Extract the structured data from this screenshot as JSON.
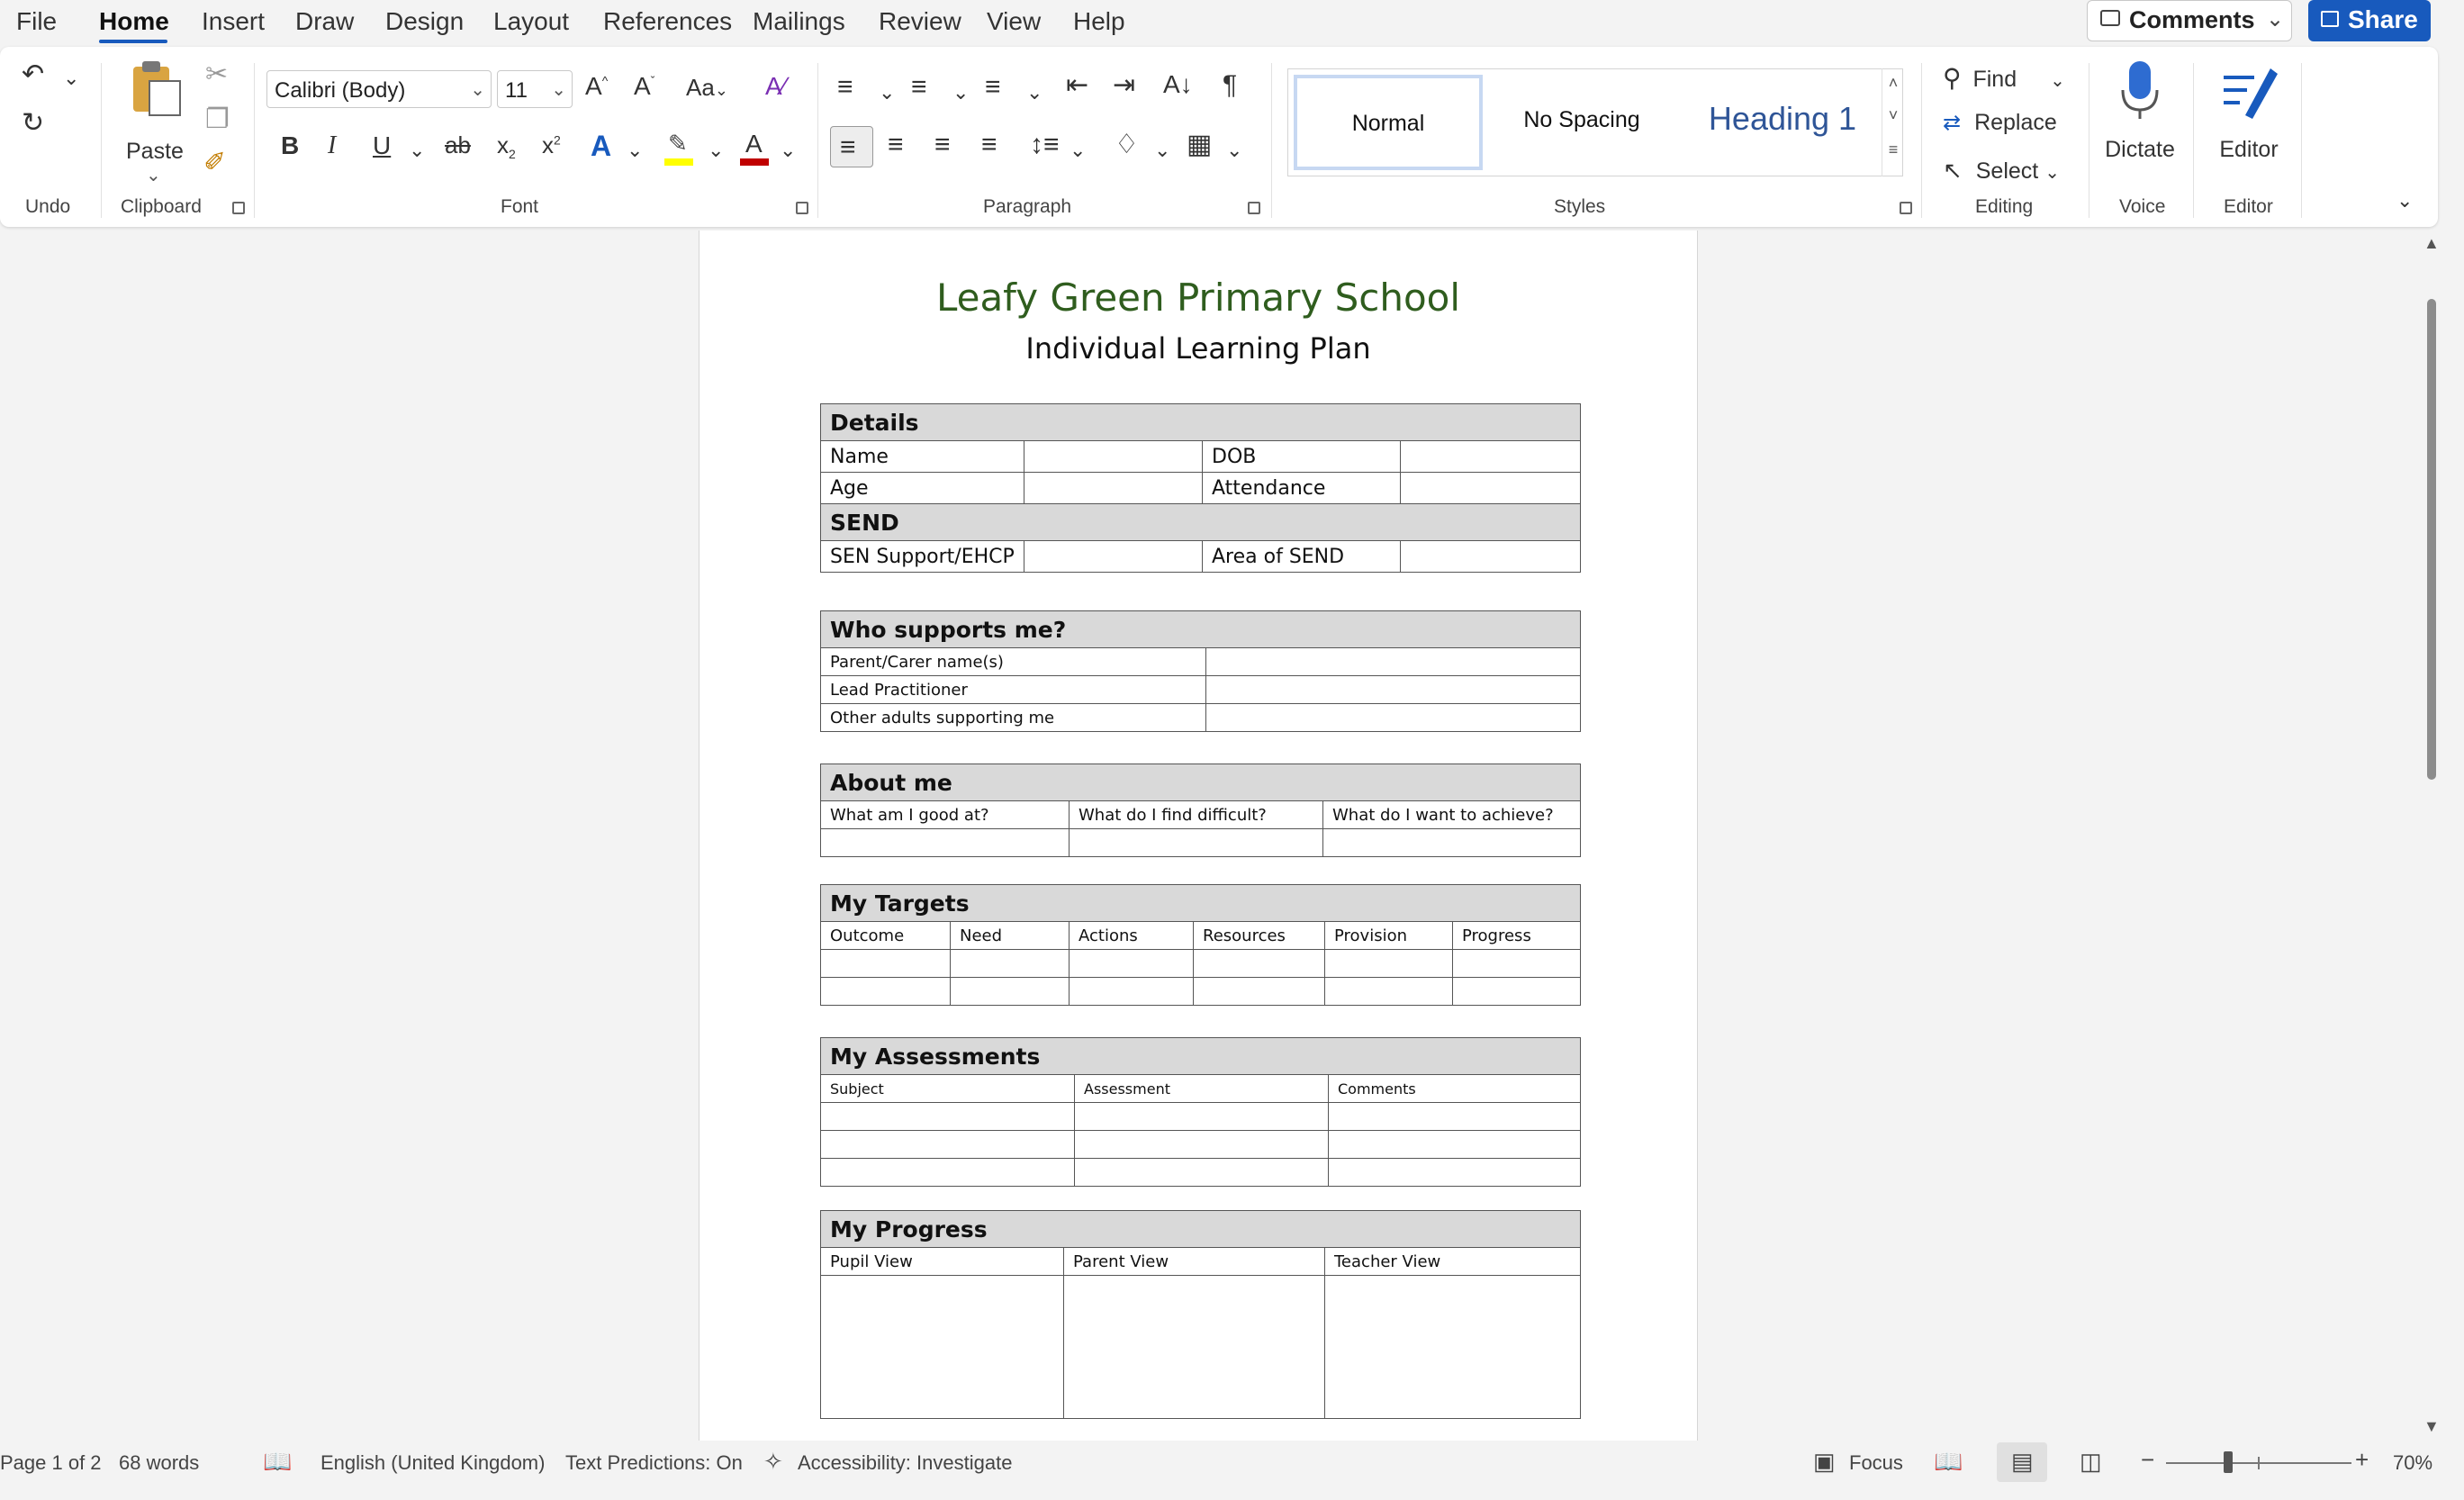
{
  "menu": {
    "tabs": [
      "File",
      "Home",
      "Insert",
      "Draw",
      "Design",
      "Layout",
      "References",
      "Mailings",
      "Review",
      "View",
      "Help"
    ],
    "active": "Home",
    "comments_label": "Comments",
    "share_label": "Share"
  },
  "ribbon": {
    "groups": {
      "undo": "Undo",
      "clipboard": "Clipboard",
      "font": "Font",
      "paragraph": "Paragraph",
      "styles": "Styles",
      "editing": "Editing",
      "voice": "Voice",
      "editor": "Editor"
    },
    "paste_label": "Paste",
    "font_name": "Calibri (Body)",
    "font_size": "11",
    "styles": [
      "Normal",
      "No Spacing",
      "Heading 1"
    ],
    "find_label": "Find",
    "replace_label": "Replace",
    "select_label": "Select",
    "dictate_label": "Dictate",
    "editor_label": "Editor",
    "icons": [
      "undo-icon",
      "redo-icon",
      "paste-icon",
      "cut-icon",
      "copy-icon",
      "format-painter-icon",
      "grow-font-icon",
      "shrink-font-icon",
      "change-case-icon",
      "clear-formatting-icon",
      "bold-icon",
      "italic-icon",
      "underline-icon",
      "strikethrough-icon",
      "subscript-icon",
      "superscript-icon",
      "text-effects-icon",
      "highlight-icon",
      "font-color-icon",
      "bullets-icon",
      "numbering-icon",
      "multilevel-list-icon",
      "decrease-indent-icon",
      "increase-indent-icon",
      "sort-icon",
      "show-marks-icon",
      "align-left-icon",
      "center-icon",
      "align-right-icon",
      "justify-icon",
      "line-spacing-icon",
      "shading-icon",
      "borders-icon",
      "find-icon",
      "replace-icon",
      "select-icon",
      "microphone-icon",
      "editor-pen-icon"
    ],
    "colors": {
      "highlight": "#ffff00",
      "font_color": "#c00000",
      "accent": "#185abd"
    }
  },
  "document": {
    "title": "Leafy Green Primary School",
    "subtitle": "Individual Learning Plan",
    "title_color": "#2f5d1e",
    "details": {
      "heading": "Details",
      "name": "Name",
      "dob": "DOB",
      "age": "Age",
      "attendance": "Attendance",
      "send_heading": "SEND",
      "sen_support": "SEN Support/EHCP",
      "area_of_send": "Area of SEND"
    },
    "supports": {
      "heading": "Who supports me?",
      "rows": [
        "Parent/Carer name(s)",
        "Lead Practitioner",
        "Other adults supporting me"
      ]
    },
    "about": {
      "heading": "About me",
      "cols": [
        "What am I good at?",
        "What do I find difficult?",
        "What do I want to achieve?"
      ]
    },
    "targets": {
      "heading": "My Targets",
      "cols": [
        "Outcome",
        "Need",
        "Actions",
        "Resources",
        "Provision",
        "Progress"
      ]
    },
    "assessments": {
      "heading": "My Assessments",
      "cols": [
        "Subject",
        "Assessment",
        "Comments"
      ]
    },
    "progress": {
      "heading": "My Progress",
      "cols": [
        "Pupil View",
        "Parent View",
        "Teacher View"
      ]
    }
  },
  "status": {
    "page": "Page 1 of 2",
    "words": "68 words",
    "language": "English (United Kingdom)",
    "predictions": "Text Predictions: On",
    "accessibility": "Accessibility: Investigate",
    "focus": "Focus",
    "zoom": "70%"
  }
}
